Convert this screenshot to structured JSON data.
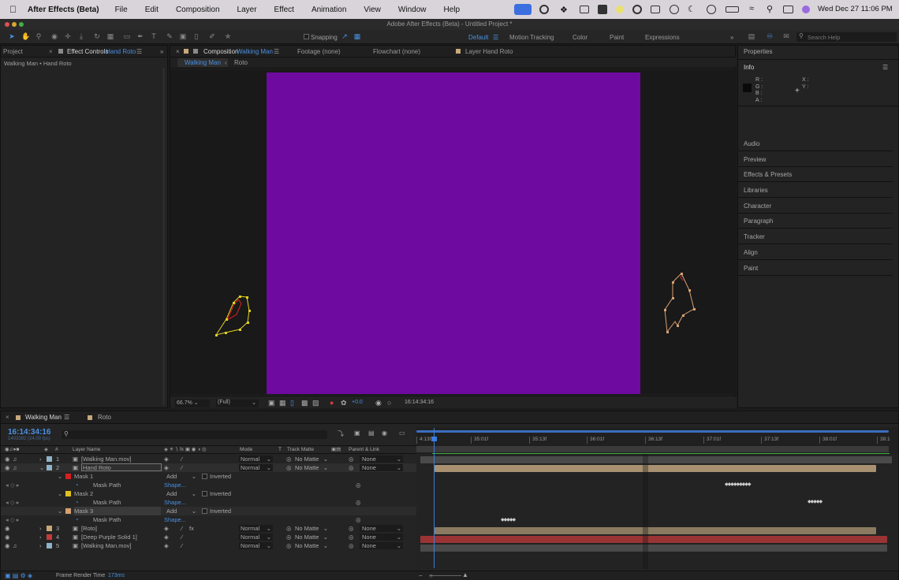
{
  "menubar": {
    "app_name": "After Effects (Beta)",
    "items": [
      "File",
      "Edit",
      "Composition",
      "Layer",
      "Effect",
      "Animation",
      "View",
      "Window",
      "Help"
    ],
    "clock": "Wed Dec 27  11:06 PM"
  },
  "window": {
    "title": "Adobe After Effects (Beta) - Untitled Project *"
  },
  "toolbar": {
    "snapping": "Snapping",
    "workspaces": [
      "Default",
      "Motion Tracking",
      "Color",
      "Paint",
      "Expressions"
    ],
    "search_placeholder": "Search Help"
  },
  "left_panel": {
    "tab_project": "Project",
    "tab_effect_controls": "Effect Controls",
    "effect_layer": "Hand Roto",
    "breadcrumb": "Walking Man • Hand Roto"
  },
  "viewer": {
    "tab_label": "Composition",
    "tab_comp": "Walking Man",
    "footage": "Footage (none)",
    "flowchart": "Flowchart (none)",
    "layer_tab": "Layer Hand Roto",
    "subtab_active": "Walking Man",
    "subtab_other": "Roto",
    "zoom": "66.7%",
    "resolution": "(Full)",
    "exposure": "+0.0",
    "timecode": "16:14:34:16",
    "comp_color": "#6e0aa0"
  },
  "right_panel": {
    "properties": "Properties",
    "info": "Info",
    "info_rgb": [
      "R :",
      "G :",
      "B :",
      "A :"
    ],
    "info_xy": [
      "X :",
      "Y :"
    ],
    "items": [
      "Audio",
      "Preview",
      "Effects & Presets",
      "Libraries",
      "Character",
      "Paragraph",
      "Tracker",
      "Align",
      "Paint"
    ]
  },
  "timeline": {
    "tab_active": "Walking Man",
    "tab_other": "Roto",
    "timecode": "16:14:34:16",
    "frame_info": "1403392 (24.00 fps)",
    "columns": {
      "layer_name": "Layer Name",
      "mode": "Mode",
      "t": "T",
      "track_matte": "Track Matte",
      "parent": "Parent & Link"
    },
    "ruler": [
      "4:13f",
      "35:01f",
      "35:13f",
      "36:01f",
      "36:13f",
      "37:01f",
      "37:13f",
      "38:01f",
      "38:1"
    ],
    "layers": [
      {
        "num": "1",
        "name": "[Walking Man.mov]",
        "mode": "Normal",
        "matte": "No Matte",
        "parent": "None",
        "color": "#8fb3c8"
      },
      {
        "num": "2",
        "name": "Hand Roto",
        "mode": "Normal",
        "matte": "No Matte",
        "parent": "None",
        "color": "#8fb3c8"
      },
      {
        "num": "3",
        "name": "[Roto]",
        "mode": "Normal",
        "matte": "No Matte",
        "parent": "None",
        "color": "#c8a87a"
      },
      {
        "num": "4",
        "name": "[Deep Purple Solid 1]",
        "mode": "Normal",
        "matte": "No Matte",
        "parent": "None",
        "color": "#c83a3a"
      },
      {
        "num": "5",
        "name": "[Walking Man.mov]",
        "mode": "Normal",
        "matte": "No Matte",
        "parent": "None",
        "color": "#8fb3c8"
      }
    ],
    "masks": [
      {
        "name": "Mask 1",
        "mode": "Add",
        "inverted": "Inverted",
        "path": "Mask Path",
        "value": "Shape...",
        "color": "#d42020"
      },
      {
        "name": "Mask 2",
        "mode": "Add",
        "inverted": "Inverted",
        "path": "Mask Path",
        "value": "Shape...",
        "color": "#e0c020"
      },
      {
        "name": "Mask 3",
        "mode": "Add",
        "inverted": "Inverted",
        "path": "Mask Path",
        "value": "Shape...",
        "color": "#d8a070"
      }
    ],
    "render_time_label": "Frame Render Time",
    "render_time": "173ms"
  }
}
